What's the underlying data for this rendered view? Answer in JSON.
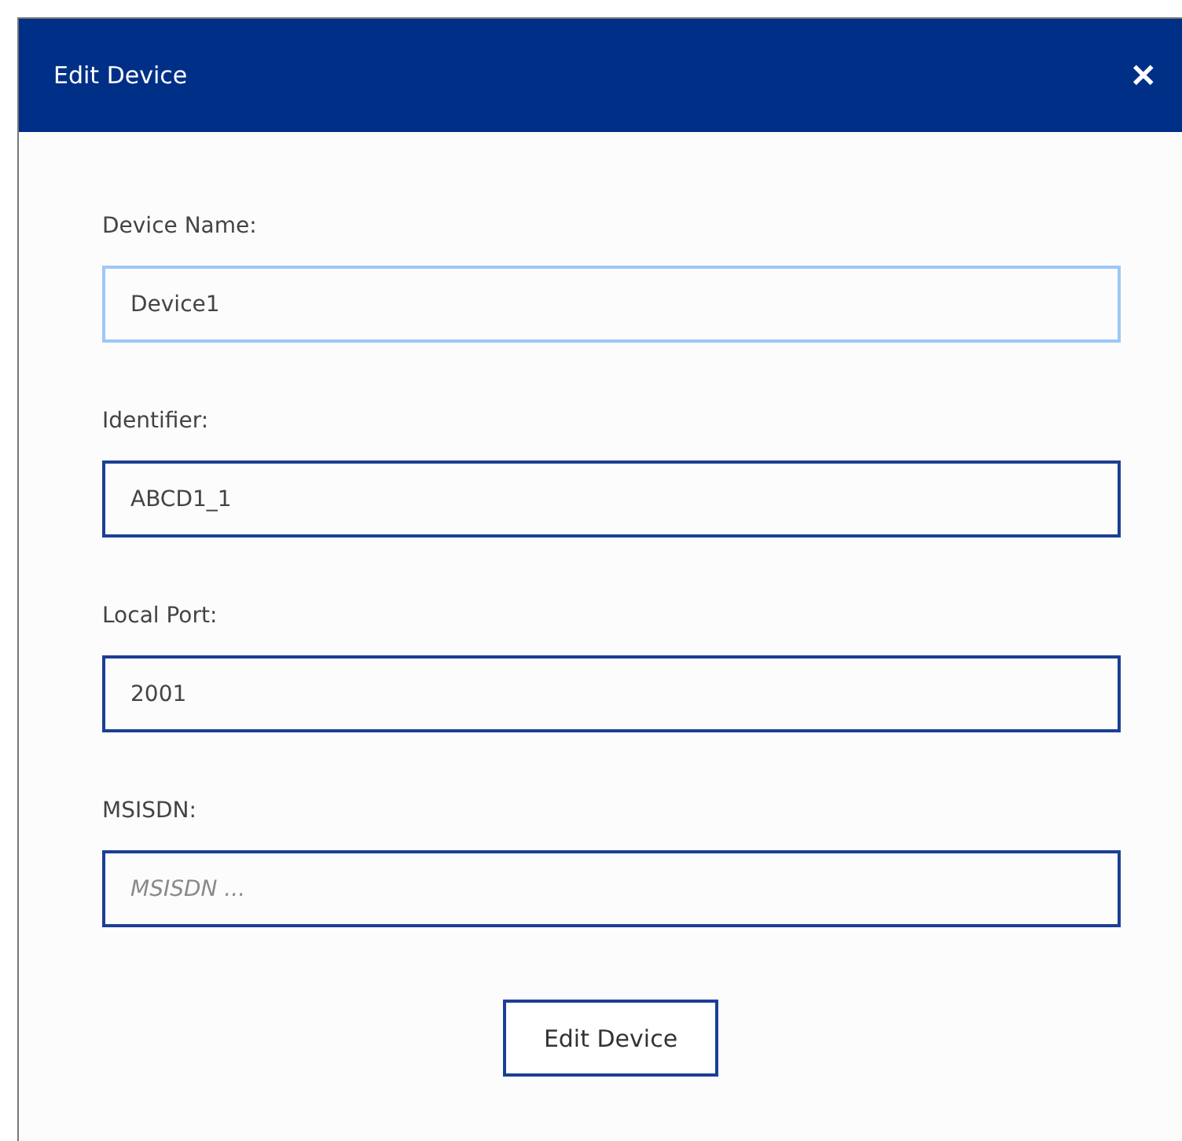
{
  "window": {
    "title": "Edit Device",
    "close": "✕"
  },
  "fields": [
    {
      "label": "Device Name:",
      "value": "Device1",
      "focused": true
    },
    {
      "label": "Identifier:",
      "value": "ABCD1_1",
      "focused": false
    },
    {
      "label": "Local Port:",
      "value": "2001",
      "focused": false
    },
    {
      "label": "MSISDN:",
      "placeholder": "MSISDN ...",
      "focused": false
    }
  ],
  "submit": "Edit Device"
}
